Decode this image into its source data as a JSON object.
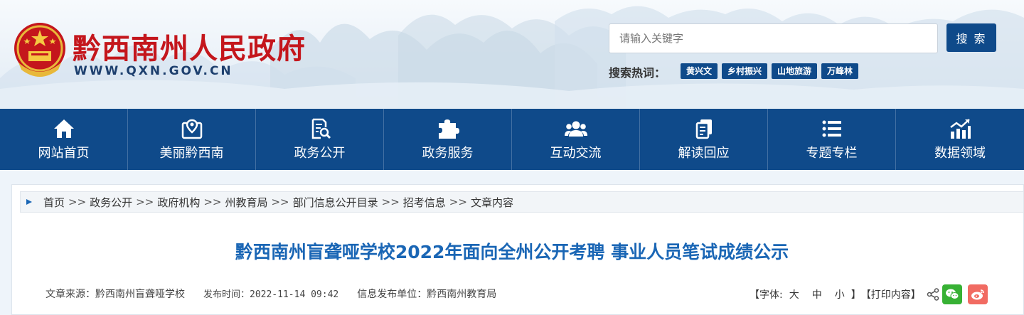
{
  "header": {
    "site_name": "黔西南州人民政府",
    "site_url": "WWW.QXN.GOV.CN",
    "search_placeholder": "请输入关键字",
    "search_button": "搜 索",
    "hot_label": "搜索热词：",
    "hot_tags": [
      "黄兴文",
      "乡村振兴",
      "山地旅游",
      "万峰林"
    ]
  },
  "nav": {
    "items": [
      {
        "label": "网站首页",
        "icon": "home-icon"
      },
      {
        "label": "美丽黔西南",
        "icon": "map-pin-icon"
      },
      {
        "label": "政务公开",
        "icon": "document-search-icon"
      },
      {
        "label": "政务服务",
        "icon": "puzzle-icon"
      },
      {
        "label": "互动交流",
        "icon": "users-icon"
      },
      {
        "label": "解读回应",
        "icon": "copy-document-icon"
      },
      {
        "label": "专题专栏",
        "icon": "list-icon"
      },
      {
        "label": "数据领域",
        "icon": "chart-trend-icon"
      }
    ]
  },
  "breadcrumb": {
    "items": [
      "首页",
      "政务公开",
      "政府机构",
      "州教育局",
      "部门信息公开目录",
      "招考信息",
      "文章内容"
    ],
    "separator": ">>"
  },
  "article": {
    "title": "黔西南州盲聋哑学校2022年面向全州公开考聘 事业人员笔试成绩公示",
    "source": "文章来源：黔西南州盲聋哑学校",
    "publish_time": "发布时间：2022-11-14 09:42",
    "publisher": "信息发布单位：黔西南州教育局"
  },
  "tools": {
    "font_open": "【字体:",
    "font_large": "大",
    "font_medium": "中",
    "font_small": "小",
    "font_close": "】",
    "print": "【打印内容】"
  },
  "colors": {
    "nav_bg": "#0f4a8a",
    "title": "#1a66b5",
    "site_name": "#c4161c",
    "wechat": "#37b134",
    "weibo": "#f16b62"
  }
}
